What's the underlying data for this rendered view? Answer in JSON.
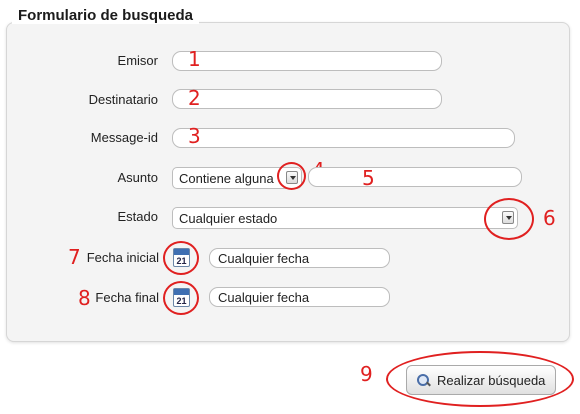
{
  "form": {
    "title": "Formulario de busqueda",
    "emisor": {
      "label": "Emisor",
      "value": "",
      "annotation": "1"
    },
    "destinatario": {
      "label": "Destinatario",
      "value": "",
      "annotation": "2"
    },
    "message_id": {
      "label": "Message-id",
      "value": "",
      "annotation": "3"
    },
    "asunto": {
      "label": "Asunto",
      "select_value": "Contiene alguna",
      "select_annotation": "4",
      "text_value": "",
      "text_annotation": "5"
    },
    "estado": {
      "label": "Estado",
      "select_value": "Cualquier estado",
      "annotation": "6"
    },
    "fecha_inicial": {
      "label": "Fecha inicial",
      "value": "Cualquier fecha",
      "calendar_day": "21",
      "annotation": "7"
    },
    "fecha_final": {
      "label": "Fecha final",
      "value": "Cualquier fecha",
      "calendar_day": "21",
      "annotation": "8"
    }
  },
  "search_button": {
    "label": "Realizar búsqueda",
    "annotation": "9",
    "icon": "magnifier-icon"
  },
  "colors": {
    "annotation": "#e02020",
    "panel_bg": "#f4f4f4"
  }
}
